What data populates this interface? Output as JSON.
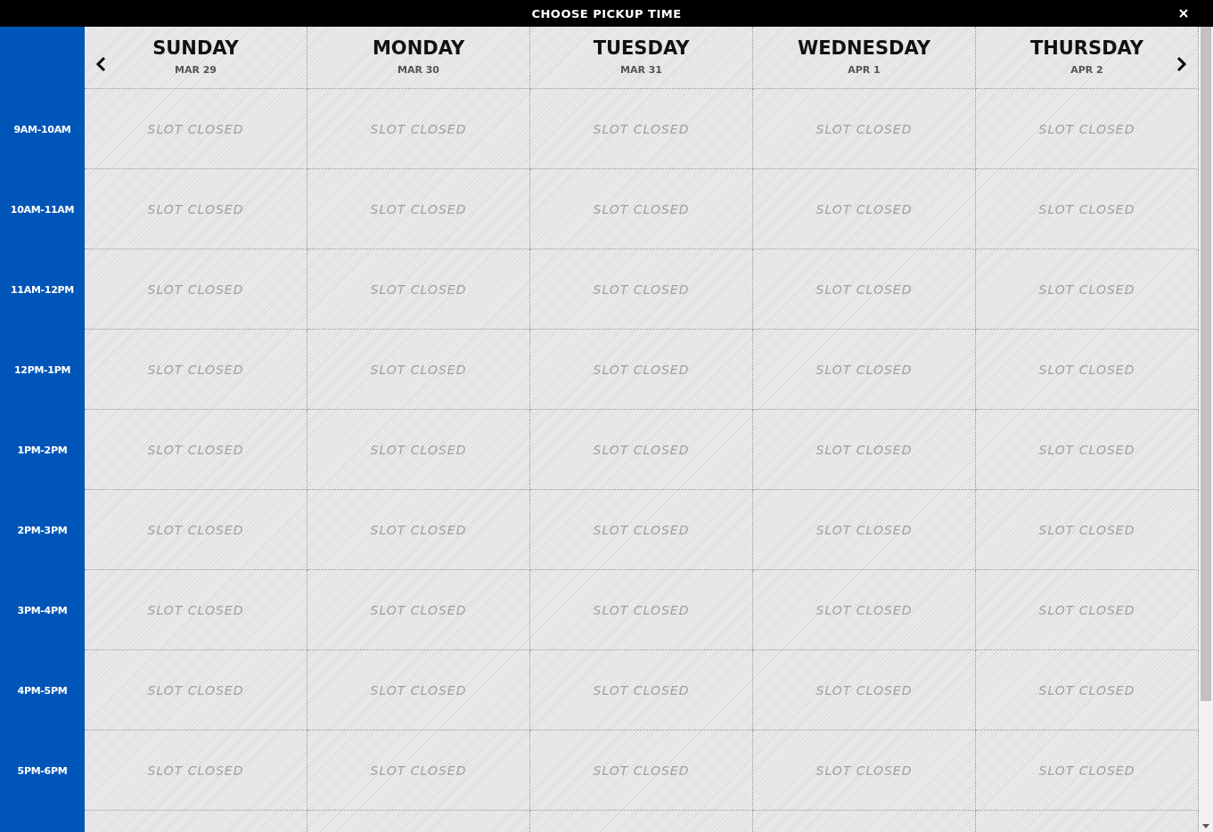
{
  "header": {
    "title": "CHOOSE PICKUP TIME"
  },
  "days": [
    {
      "name": "SUNDAY",
      "date": "MAR 29"
    },
    {
      "name": "MONDAY",
      "date": "MAR 30"
    },
    {
      "name": "TUESDAY",
      "date": "MAR 31"
    },
    {
      "name": "WEDNESDAY",
      "date": "APR 1"
    },
    {
      "name": "THURSDAY",
      "date": "APR 2"
    }
  ],
  "rows": [
    {
      "time": "9AM-10AM",
      "cells": [
        "SLOT CLOSED",
        "SLOT CLOSED",
        "SLOT CLOSED",
        "SLOT CLOSED",
        "SLOT CLOSED"
      ]
    },
    {
      "time": "10AM-11AM",
      "cells": [
        "SLOT CLOSED",
        "SLOT CLOSED",
        "SLOT CLOSED",
        "SLOT CLOSED",
        "SLOT CLOSED"
      ]
    },
    {
      "time": "11AM-12PM",
      "cells": [
        "SLOT CLOSED",
        "SLOT CLOSED",
        "SLOT CLOSED",
        "SLOT CLOSED",
        "SLOT CLOSED"
      ]
    },
    {
      "time": "12PM-1PM",
      "cells": [
        "SLOT CLOSED",
        "SLOT CLOSED",
        "SLOT CLOSED",
        "SLOT CLOSED",
        "SLOT CLOSED"
      ]
    },
    {
      "time": "1PM-2PM",
      "cells": [
        "SLOT CLOSED",
        "SLOT CLOSED",
        "SLOT CLOSED",
        "SLOT CLOSED",
        "SLOT CLOSED"
      ]
    },
    {
      "time": "2PM-3PM",
      "cells": [
        "SLOT CLOSED",
        "SLOT CLOSED",
        "SLOT CLOSED",
        "SLOT CLOSED",
        "SLOT CLOSED"
      ]
    },
    {
      "time": "3PM-4PM",
      "cells": [
        "SLOT CLOSED",
        "SLOT CLOSED",
        "SLOT CLOSED",
        "SLOT CLOSED",
        "SLOT CLOSED"
      ]
    },
    {
      "time": "4PM-5PM",
      "cells": [
        "SLOT CLOSED",
        "SLOT CLOSED",
        "SLOT CLOSED",
        "SLOT CLOSED",
        "SLOT CLOSED"
      ]
    },
    {
      "time": "5PM-6PM",
      "cells": [
        "SLOT CLOSED",
        "SLOT CLOSED",
        "SLOT CLOSED",
        "SLOT CLOSED",
        "SLOT CLOSED"
      ]
    }
  ]
}
